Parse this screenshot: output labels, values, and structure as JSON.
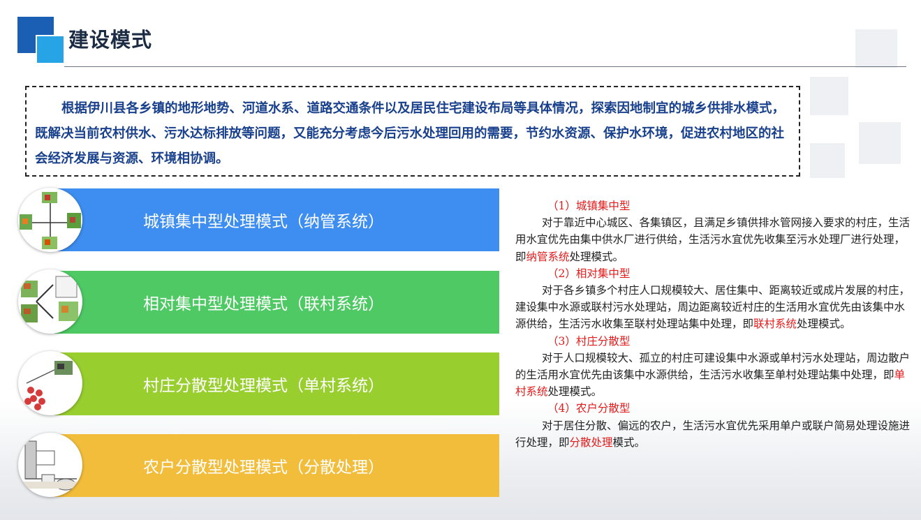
{
  "header": {
    "title": "建设模式"
  },
  "intro": {
    "text": "根据伊川县各乡镇的地形地势、河道水系、道路交通条件以及居民住宅建设布局等具体情况，探索因地制宜的城乡供排水模式，既解决当前农村供水、污水达标排放等问题，又能充分考虑今后污水处理回用的需要，节约水资源、保护水环境，促进农村地区的社会经济发展与资源、环境相协调。"
  },
  "modes": [
    {
      "label": "城镇集中型处理模式（纳管系统）",
      "color": "#3d8ef0"
    },
    {
      "label": "相对集中型处理模式（联村系统）",
      "color": "#4ec964"
    },
    {
      "label": "村庄分散型处理模式（单村系统）",
      "color": "#98cf2f"
    },
    {
      "label": "农户分散型处理模式（分散处理）",
      "color": "#f3bd3c"
    }
  ],
  "details": [
    {
      "heading": "（1）城镇集中型",
      "body_before": "对于靠近中心城区、各集镇区，且满足乡镇供排水管网接入要求的村庄，生活用水宜优先由集中供水厂进行供给，生活污水宜优先收集至污水处理厂进行处理，即",
      "body_highlight": "纳管系统",
      "body_after": "处理模式。"
    },
    {
      "heading": "（2）相对集中型",
      "body_before": "对于各乡镇多个村庄人口规模较大、居住集中、距离较近或成片发展的村庄，建设集中水源或联村污水处理站，周边距离较近村庄的生活用水宜优先由该集中水源供给，生活污水收集至联村处理站集中处理，即",
      "body_highlight": "联村系统",
      "body_after": "处理模式。"
    },
    {
      "heading": "（3）村庄分散型",
      "body_before": "对于人口规模较大、孤立的村庄可建设集中水源或单村污水处理站，周边散户的生活用水宜优先由该集中水源供给，生活污水收集至单村处理站集中处理，即",
      "body_highlight": "单村系统",
      "body_after": "处理模式。"
    },
    {
      "heading": "（4）农户分散型",
      "body_before": "对于居住分散、偏远的农户，生活污水宜优先采用单户或联户简易处理设施进行处理，即",
      "body_highlight": "分散处理",
      "body_after": "模式。"
    }
  ],
  "colors": {
    "title": "#1b2b44",
    "intro_text": "#18408c",
    "logo_dark": "#1a5fb4",
    "logo_light": "#26a4e6",
    "highlight": "#e31b1b"
  }
}
